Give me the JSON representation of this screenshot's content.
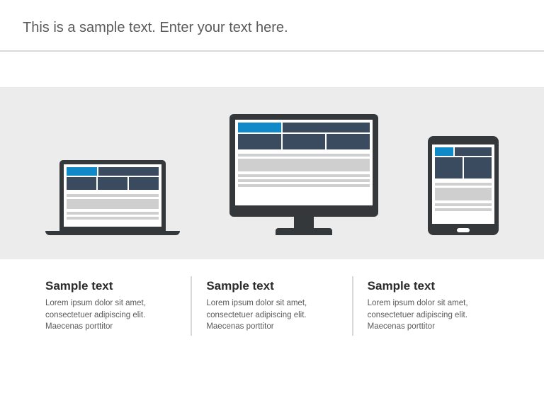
{
  "header": {
    "title": "This is a sample text. Enter your text here."
  },
  "colors": {
    "accent_blue": "#1089c9",
    "navy": "#3a4a5f",
    "device_dark": "#34383b",
    "band_bg": "#ececec"
  },
  "devices": [
    "laptop",
    "desktop-monitor",
    "tablet"
  ],
  "captions": [
    {
      "title": "Sample text",
      "body": "Lorem ipsum dolor sit amet, consectetuer adipiscing elit. Maecenas porttitor"
    },
    {
      "title": "Sample text",
      "body": "Lorem ipsum dolor sit amet, consectetuer adipiscing elit. Maecenas porttitor"
    },
    {
      "title": "Sample text",
      "body": "Lorem ipsum dolor sit amet, consectetuer adipiscing elit. Maecenas porttitor"
    }
  ]
}
